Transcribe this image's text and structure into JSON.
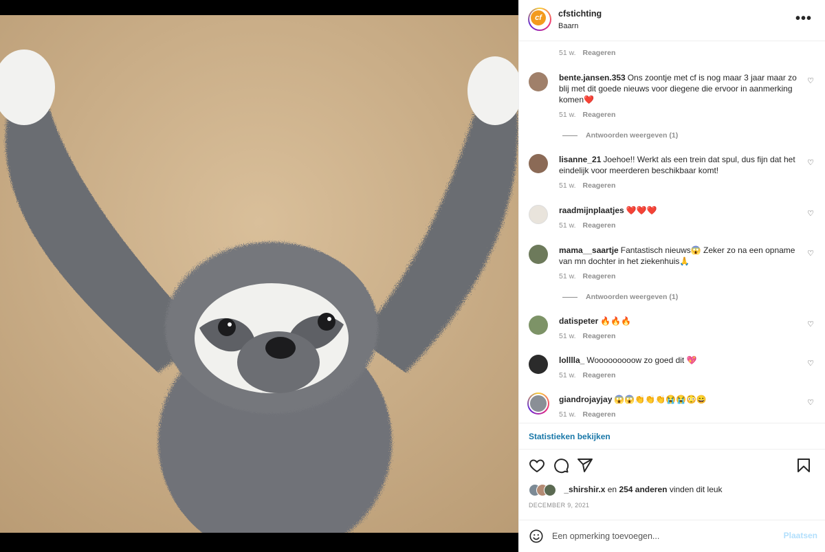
{
  "header": {
    "username": "cfstichting",
    "location": "Baarn",
    "avatar_text": "cf"
  },
  "comments": [
    {
      "user": "",
      "text": "",
      "time": "51 w.",
      "reply": "Reageren"
    },
    {
      "user": "bente.jansen.353",
      "text": "Ons zoontje met cf is nog maar 3 jaar maar zo blij met dit goede nieuws voor diegene die ervoor in aanmerking komen❤️",
      "time": "51 w.",
      "reply": "Reageren",
      "view_replies": "Antwoorden weergeven (1)"
    },
    {
      "user": "lisanne_21",
      "text": "Joehoe!! Werkt als een trein dat spul, dus fijn dat het eindelijk voor meerderen beschikbaar komt!",
      "time": "51 w.",
      "reply": "Reageren"
    },
    {
      "user": "raadmijnplaatjes",
      "text": "❤️❤️❤️",
      "time": "51 w.",
      "reply": "Reageren"
    },
    {
      "user": "mama__saartje",
      "text": "Fantastisch nieuws😱 Zeker zo na een opname van mn dochter in het ziekenhuis🙏",
      "time": "51 w.",
      "reply": "Reageren",
      "view_replies": "Antwoorden weergeven (1)"
    },
    {
      "user": "datispeter",
      "text": "🔥🔥🔥",
      "time": "51 w.",
      "reply": "Reageren"
    },
    {
      "user": "lolllla_",
      "text": "Wooooooooow zo goed dit 💖",
      "time": "51 w.",
      "reply": "Reageren"
    },
    {
      "user": "giandrojayjay",
      "text": "😱😱👏👏👏😭😭😳😄",
      "time": "51 w.",
      "reply": "Reageren"
    }
  ],
  "stats_link": "Statistieken bekijken",
  "likes": {
    "user": "_shirshir.x",
    "connector": "en",
    "others": "254 anderen",
    "suffix": "vinden dit leuk"
  },
  "date": "DECEMBER 9, 2021",
  "add_comment": {
    "placeholder": "Een opmerking toevoegen...",
    "post_label": "Plaatsen"
  },
  "icons": [
    "more-icon",
    "heart-icon",
    "comment-icon",
    "share-icon",
    "bookmark-icon",
    "emoji-icon"
  ]
}
